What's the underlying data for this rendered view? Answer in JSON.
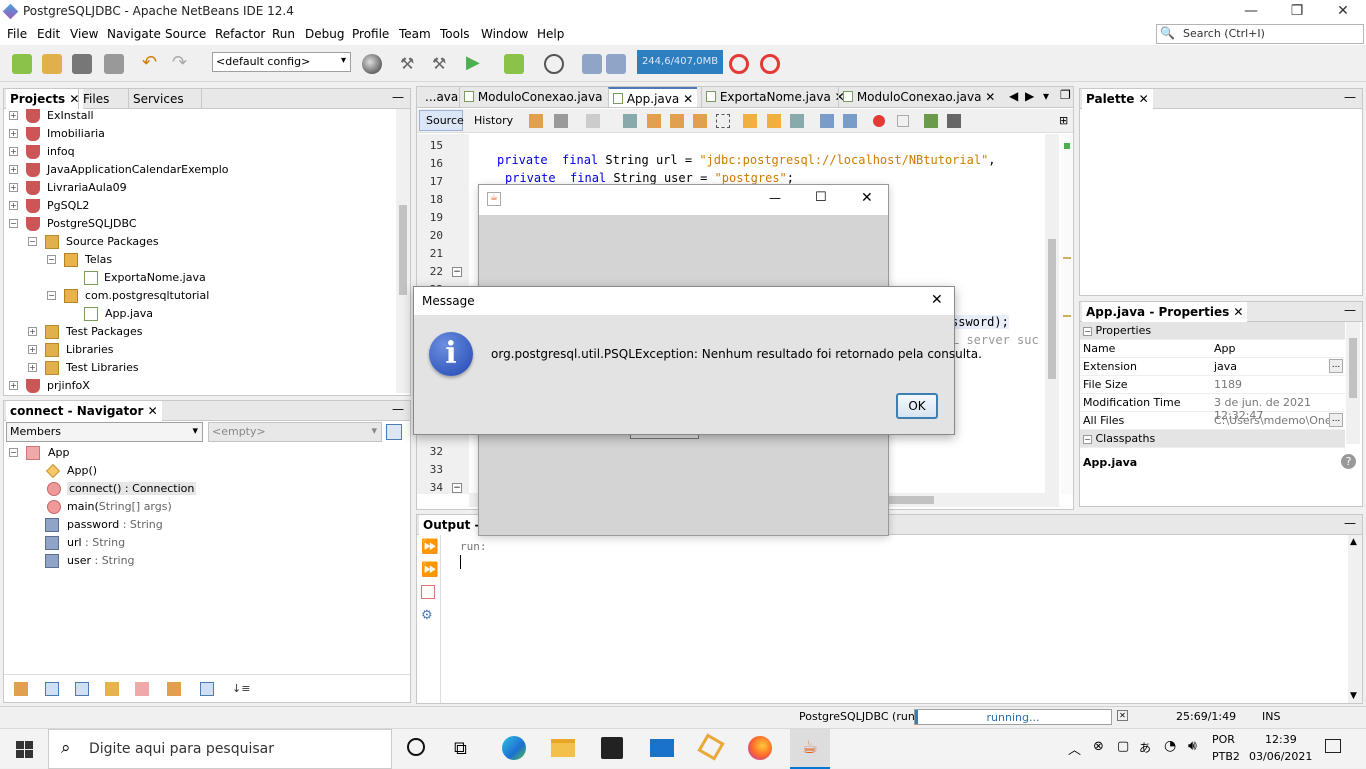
{
  "window": {
    "title": "PostgreSQLJDBC - Apache NetBeans IDE 12.4"
  },
  "menu": [
    "File",
    "Edit",
    "View",
    "Navigate",
    "Source",
    "Refactor",
    "Run",
    "Debug",
    "Profile",
    "Team",
    "Tools",
    "Window",
    "Help"
  ],
  "search": {
    "placeholder": "Search (Ctrl+I)"
  },
  "toolbar": {
    "config": "<default config>",
    "memory": "244,6/407,0MB"
  },
  "projects_panel": {
    "tabs": [
      "Projects",
      "Files",
      "Services"
    ],
    "tree": [
      {
        "label": "ExInstall"
      },
      {
        "label": "Imobiliaria"
      },
      {
        "label": "infoq"
      },
      {
        "label": "JavaApplicationCalendarExemplo"
      },
      {
        "label": "LivrariaAula09"
      },
      {
        "label": "PgSQL2"
      },
      {
        "label": "PostgreSQLJDBC"
      },
      {
        "label": "Source Packages"
      },
      {
        "label": "Telas"
      },
      {
        "label": "ExportaNome.java"
      },
      {
        "label": "com.postgresqltutorial"
      },
      {
        "label": "App.java"
      },
      {
        "label": "Test Packages"
      },
      {
        "label": "Libraries"
      },
      {
        "label": "Test Libraries"
      },
      {
        "label": "prjinfoX"
      }
    ]
  },
  "navigator": {
    "title": "connect - Navigator",
    "filter": "Members",
    "empty": "<empty>",
    "class_name": "App",
    "members": [
      {
        "name": "App()",
        "type": ""
      },
      {
        "name": "connect()",
        "type": " : Connection"
      },
      {
        "name": "main(",
        "type": "String[] args)"
      },
      {
        "name": "password",
        "type": " : String"
      },
      {
        "name": "url",
        "type": " : String"
      },
      {
        "name": "user",
        "type": " : String"
      }
    ]
  },
  "editor": {
    "tabs": [
      "...ava",
      "ModuloConexao.java",
      "App.java",
      "ExportaNome.java",
      "ModuloConexao.java"
    ],
    "subtabs": [
      "Source",
      "History"
    ],
    "line_numbers": [
      "15",
      "16",
      "17",
      "18",
      "19",
      "20",
      "21",
      "22",
      "23",
      "32",
      "33",
      "34"
    ],
    "line16": {
      "kw1": "private",
      "kw2": "final",
      "rest": " String url = ",
      "str": "\"jdbc:postgresql://localhost/NBtutorial\"",
      "end": ","
    },
    "line17": {
      "kw1": "private",
      "kw2": "final",
      "rest": " String user = ",
      "str": "\"postgres\"",
      "end": ";"
    },
    "frag1": "ssword);",
    "frag2": "L server suc"
  },
  "palette": {
    "title": "Palette"
  },
  "properties": {
    "title": "App.java - Properties",
    "section1": "Properties",
    "rows": [
      {
        "k": "Name",
        "v": "App"
      },
      {
        "k": "Extension",
        "v": "java"
      },
      {
        "k": "File Size",
        "v": "1189"
      },
      {
        "k": "Modification Time",
        "v": "3 de jun. de 2021 12:32:47"
      },
      {
        "k": "All Files",
        "v": "C:\\Users\\mdemo\\One..."
      }
    ],
    "section2": "Classpaths",
    "footer": "App.java"
  },
  "output": {
    "title": "Output - Po",
    "run": "run:"
  },
  "dialog": {
    "title": "Message",
    "message": "org.postgresql.util.PSQLException: Nenhum resultado foi retornado pela consulta.",
    "ok": "OK"
  },
  "status": {
    "project": "PostgreSQLJDBC (run)",
    "progress": "running...",
    "position": "25:69/1:49",
    "mode": "INS"
  },
  "taskbar": {
    "search_placeholder": "Digite aqui para pesquisar",
    "lang": "POR",
    "layout": "PTB2",
    "time": "12:39",
    "date": "03/06/2021"
  },
  "colors": {
    "accent": "#2d7fc0",
    "keyword": "#0000e6",
    "string": "#ce7b00"
  }
}
